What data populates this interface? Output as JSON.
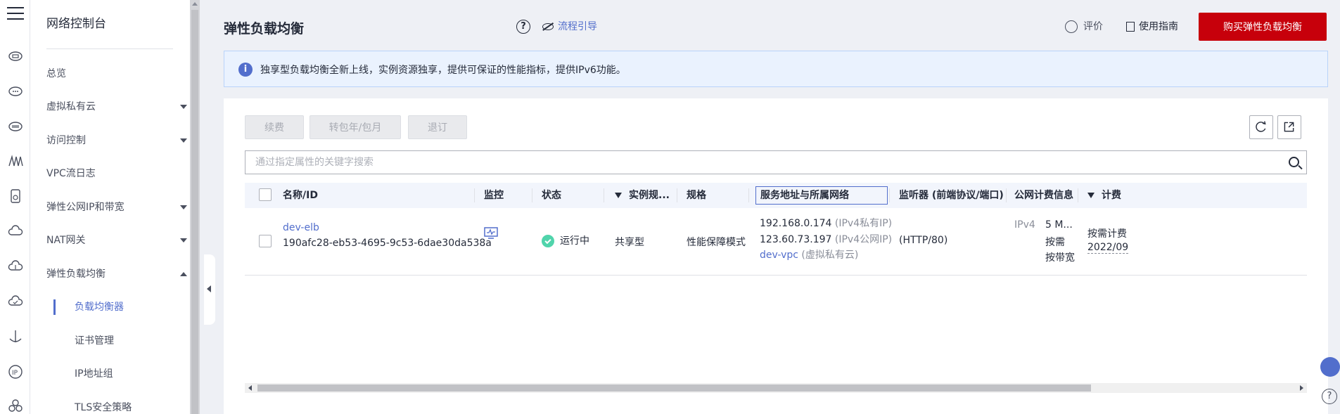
{
  "rail": {
    "icons": [
      "cloud-server-icon",
      "cloud-chat-icon",
      "cloud-db-icon",
      "network-icon",
      "device-icon",
      "cloud-icon",
      "cloud-upload-icon",
      "cloud-check-icon",
      "anchor-icon",
      "ip-icon",
      "cluster-icon"
    ]
  },
  "sidebar": {
    "title": "网络控制台",
    "items": [
      {
        "label": "总览"
      },
      {
        "label": "虚拟私有云"
      },
      {
        "label": "访问控制"
      },
      {
        "label": "VPC流日志"
      },
      {
        "label": "弹性公网IP和带宽"
      },
      {
        "label": "NAT网关"
      },
      {
        "label": "弹性负载均衡"
      }
    ],
    "sub_items": [
      {
        "label": "负载均衡器"
      },
      {
        "label": "证书管理"
      },
      {
        "label": "IP地址组"
      },
      {
        "label": "TLS安全策略"
      }
    ]
  },
  "header": {
    "title": "弹性负载均衡",
    "help_symbol": "?",
    "guide_label": "流程引导",
    "rate_label": "评价",
    "doc_label": "使用指南",
    "buy_label": "购买弹性负载均衡"
  },
  "notice": {
    "text": "独享型负载均衡全新上线，实例资源独享，提供可保证的性能指标，提供IPv6功能。"
  },
  "toolbar": {
    "renew": "续费",
    "convert": "转包年/包月",
    "unsubscribe": "退订"
  },
  "search": {
    "placeholder": "通过指定属性的关键字搜索"
  },
  "table": {
    "columns": [
      "名称/ID",
      "监控",
      "状态",
      "实例规...",
      "规格",
      "服务地址与所属网络",
      "监听器 (前端协议/端口)",
      "公网计费信息",
      "计费"
    ],
    "rows": [
      {
        "name": "dev-elb",
        "id": "190afc28-eb53-4695-9c53-6dae30da538a",
        "status": "运行中",
        "instance_type": "共享型",
        "spec": "性能保障模式",
        "ip_private": "192.168.0.174",
        "ip_private_tag": "(IPv4私有IP)",
        "ip_public": "123.60.73.197",
        "ip_public_tag": "(IPv4公网IP)",
        "vpc": "dev-vpc",
        "vpc_tag": "(虚拟私有云)",
        "listener": "(HTTP/80)",
        "billing_ip": "IPv4",
        "billing_bw": "5 M...",
        "billing_mode1": "按需",
        "billing_mode2": "按带宽",
        "charge_mode": "按需计费",
        "charge_date": "2022/09"
      }
    ]
  }
}
